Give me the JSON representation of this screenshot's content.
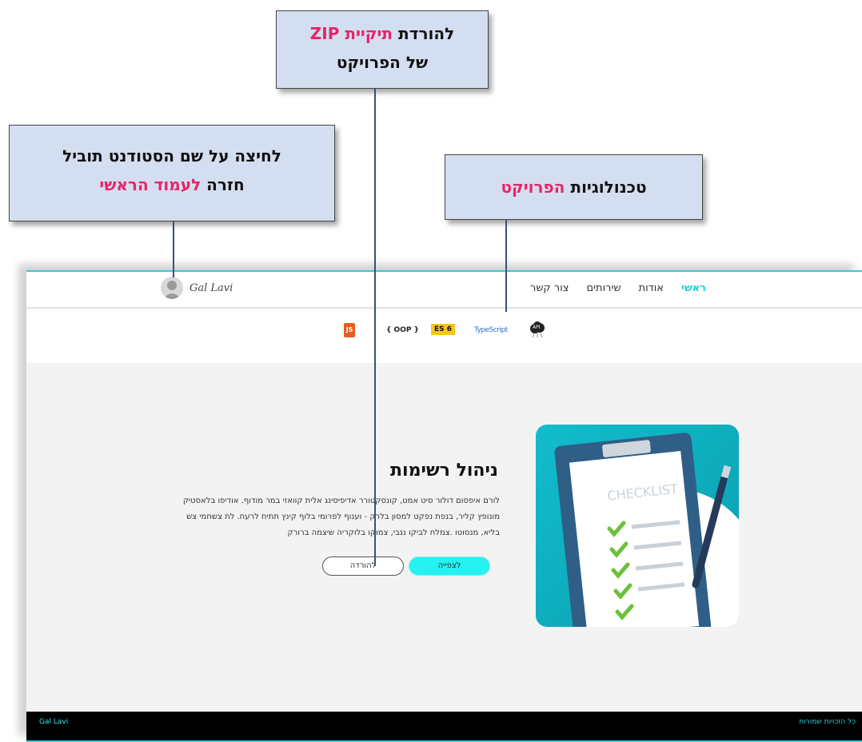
{
  "callouts": {
    "zip": {
      "line1_a": "להורדת ",
      "line1_b": "תיקיית ZIP",
      "line2": "של הפרויקט"
    },
    "home": {
      "line1": "לחיצה על שם הסטודנט תוביל",
      "line2_a": "חזרה ",
      "line2_b": "לעמוד הראשי"
    },
    "tech": {
      "a": "טכנולוגיות ",
      "b": "הפרויקט"
    }
  },
  "nav": {
    "items": [
      "ראשי",
      "אודות",
      "שירותים",
      "צור קשר"
    ],
    "brand": "Gal Lavi"
  },
  "tech": {
    "items": [
      {
        "label": "JS",
        "icon": "js-icon"
      },
      {
        "label": "{ OOP }",
        "icon": "oop-icon"
      },
      {
        "label": "ES 6",
        "icon": "es6-icon"
      },
      {
        "label": "TypeScript",
        "icon": "typescript-icon"
      },
      {
        "label": "API",
        "icon": "api-cloud-icon"
      }
    ]
  },
  "project": {
    "title": "ניהול רשימות",
    "description": "לורם איפסום דולור סיט אמט, קונסקטורר אדיפיסינג אלית קוואזי במר מודוף. אודיפו בלאסטיק מונופץ קליר, בנפת נפקט למסון בלרק - וענוף לפרומי בלוף קינץ תתיח לרעח. לת צשחמי צש בליא, מנסוטו .צמלח לביקו ננבי, צמוקו בלוקריה שיצמה ברורק",
    "view_label": "לצפייה",
    "download_label": "להורדה",
    "image_text": "CHECKLIST"
  },
  "footer": {
    "left": "Gal Lavi",
    "right": "כל הזכויות שמורות"
  },
  "colors": {
    "accent": "#1fd0d8",
    "highlight": "#e8246a",
    "callout_bg": "#d3dff0"
  }
}
